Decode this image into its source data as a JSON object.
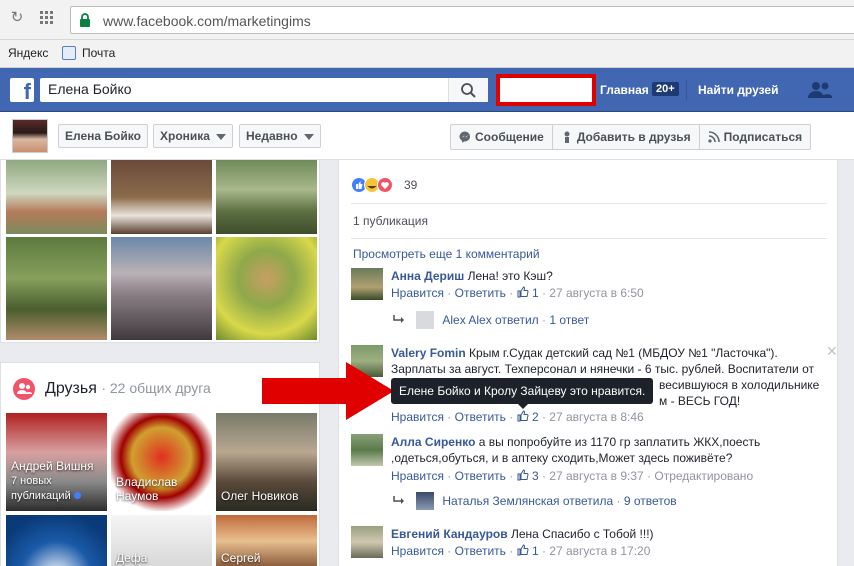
{
  "browser": {
    "url": "www.facebook.com/marketingims",
    "bookmarks": [
      {
        "label": "Яндекс"
      },
      {
        "label": "Почта"
      }
    ]
  },
  "fb_header": {
    "search_value": "Елена Бойко",
    "nav_home": "Главная",
    "nav_home_badge": "20+",
    "nav_find_friends": "Найти друзей",
    "brand_color": "#4267b2"
  },
  "profile_bar": {
    "name": "Елена Бойко",
    "timeline": "Хроника",
    "recent": "Недавно",
    "message_button": "Сообщение",
    "add_friend_button": "Добавить в друзья",
    "follow_button": "Подписаться"
  },
  "friends": {
    "title": "Друзья",
    "count": "· 22 общих друга",
    "items": [
      {
        "name": "Андрей Вишня",
        "sub": "7 новых публикаций"
      },
      {
        "name": "Владислав Наумов"
      },
      {
        "name": "Олег Новиков"
      },
      {
        "name": "Дефа"
      },
      {
        "name": ""
      },
      {
        "name": "Сергей"
      }
    ]
  },
  "post": {
    "reactions_count": "39",
    "shares": "1 публикация",
    "more_comments": "Просмотреть еще 1 комментарий"
  },
  "comments": [
    {
      "name": "Анна Дериш",
      "text": "Лена! это Кэш?",
      "like": "Нравится",
      "reply": "Ответить",
      "likes": "1",
      "date": "27 августа в 6:50",
      "reply_author": "Alex Alex",
      "reply_verb": "ответил",
      "reply_count": "1 ответ"
    },
    {
      "name": "Valery Fomin",
      "text_line1": "Крым г.Судак детский сад №1 (МБДОУ №1 \"Ласточка\").",
      "text_line2": "Зарплаты за август. Техперсонал и нянечки - 6 тыс. рублей. Воспитатели от",
      "text_line3": "весившуюся в холодильнике",
      "text_line4": "м - ВЕСЬ ГОД!",
      "like": "Нравится",
      "reply": "Ответить",
      "likes": "2",
      "date": "27 августа в 8:46"
    },
    {
      "name": "Алла Сиренко",
      "text_line1": "а вы попробуйте из 1170 гр заплатить ЖКХ,поесть",
      "text_line2": ",одеться,обуться, и в аптеку сходить,Может здесь поживёте?",
      "like": "Нравится",
      "reply": "Ответить",
      "likes": "3",
      "date": "27 августа в 9:37",
      "edited": "Отредактировано",
      "reply_author": "Наталья Землянская",
      "reply_verb": "ответила",
      "reply_count": "9 ответов"
    },
    {
      "name": "Евгений Кандауров",
      "text": "Лена Спасибо с Тобой !!!)",
      "like": "Нравится",
      "reply": "Ответить",
      "likes": "1",
      "date": "27 августа в 17:20"
    }
  ],
  "tooltip": {
    "text": "Елене Бойко и Кролу Зайцеву это нравится."
  },
  "colors": {
    "annotation_red": "#e00000",
    "link": "#385898"
  }
}
